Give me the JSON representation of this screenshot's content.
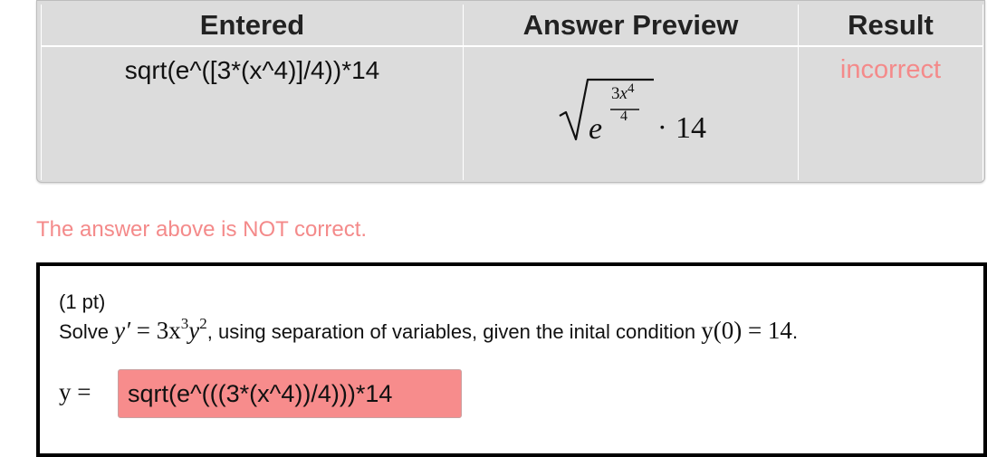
{
  "results_table": {
    "headers": {
      "entered": "Entered",
      "preview": "Answer Preview",
      "result": "Result"
    },
    "row": {
      "entered": "sqrt(e^([3*(x^4)]/4))*14",
      "preview": {
        "base": "e",
        "exp_numerator": "3x4",
        "exp_denominator": "4",
        "operator": "·",
        "factor": "14"
      },
      "result": "incorrect"
    }
  },
  "status_message": "The answer above is NOT correct.",
  "problem": {
    "points": "(1 pt)",
    "statement": {
      "prefix": "Solve ",
      "eq_lhs": "y′",
      "eq_equals": " = ",
      "eq_coef_x": "3x",
      "eq_x_exp": "3",
      "eq_y": "y",
      "eq_y_exp": "2",
      "middle": ", using separation of variables, given the inital condition ",
      "cond": "y(0) = 14",
      "suffix": "."
    },
    "answer_label": "y =",
    "answer_value": "sqrt(e^(((3*(x^4))/4)))*14"
  },
  "colors": {
    "error_text": "#f48a8a",
    "error_input_bg": "#f78c8c",
    "table_bg": "#dcdcdc"
  }
}
